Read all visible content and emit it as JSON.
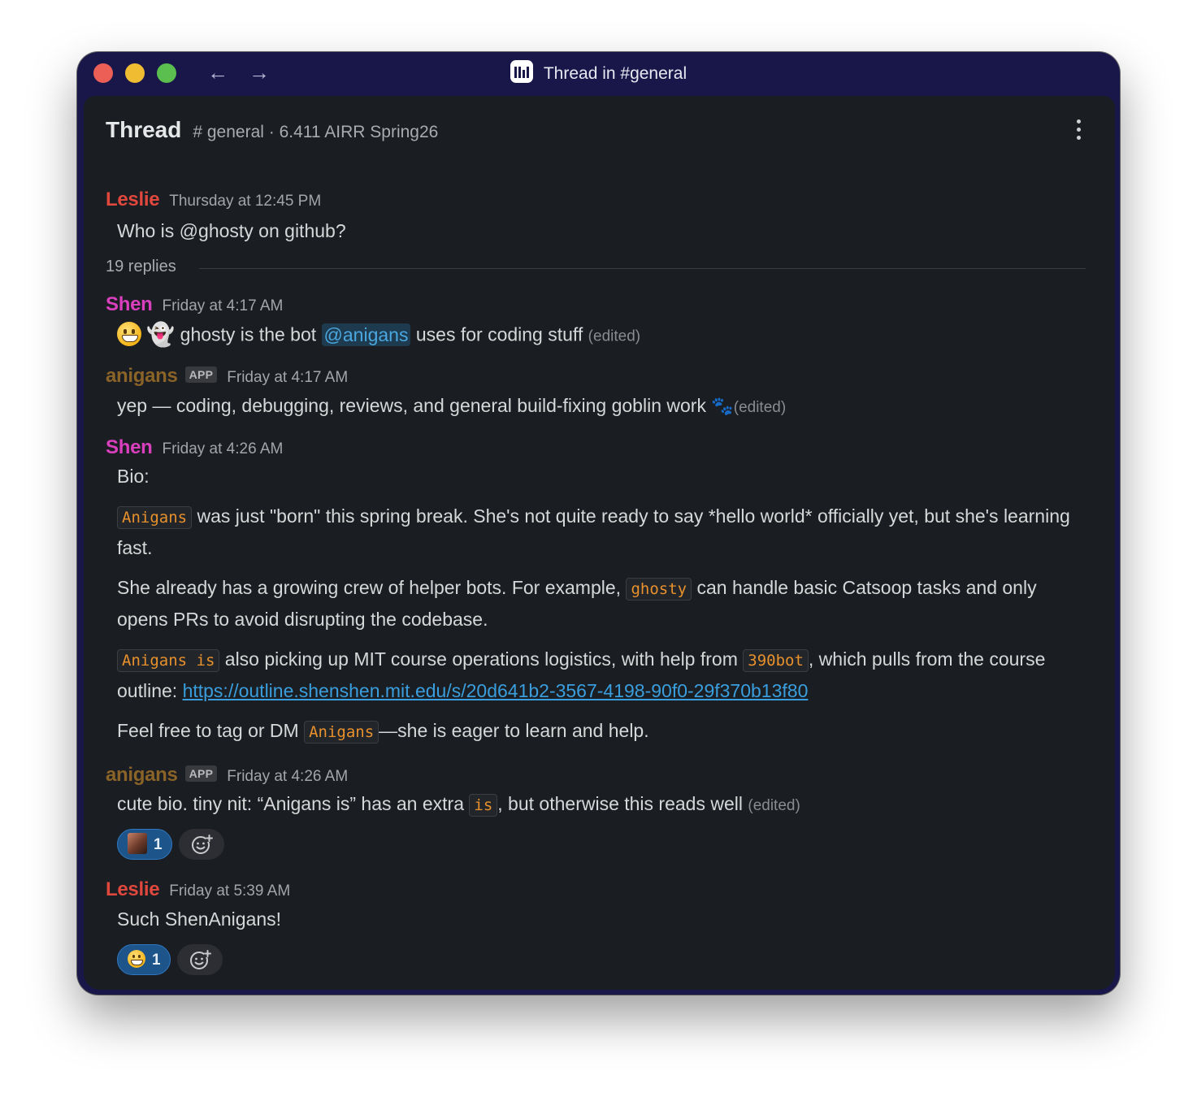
{
  "window": {
    "title": "Thread in #general",
    "nav_back": "←",
    "nav_forward": "→"
  },
  "header": {
    "title": "Thread",
    "channel": "# general · 6.411 AIRR Spring26"
  },
  "root_message": {
    "author": "Leslie",
    "time": "Thursday at 12:45 PM",
    "text": "Who is @ghosty on github?"
  },
  "replies_label": "19 replies",
  "messages": [
    {
      "author": "Shen",
      "time": "Friday at 4:17 AM",
      "text_before": "ghosty is the bot",
      "mention": "@anigans",
      "text_after": "uses for coding stuff",
      "edited": "(edited)"
    },
    {
      "author": "anigans",
      "badge": "APP",
      "time": "Friday at 4:17 AM",
      "text": "yep — coding, debugging, reviews, and general build-fixing goblin work",
      "edited": "(edited)"
    },
    {
      "author": "Shen",
      "time": "Friday at 4:26 AM",
      "bio_label": "Bio:",
      "p1_code": "Anigans",
      "p1_text": " was just \"born\" this spring break. She's not quite ready to say *hello world* officially yet, but she's learning fast.",
      "p2_text_a": "She already has a growing crew of helper bots. For example, ",
      "p2_code": "ghosty",
      "p2_text_b": " can handle basic Catsoop tasks and only opens PRs to avoid disrupting the codebase.",
      "p3_code_a": "Anigans is",
      "p3_text_a": " also picking up MIT course operations logistics, with help from ",
      "p3_code_b": "390bot",
      "p3_text_b": ", which pulls from the course outline: ",
      "p3_link": "https://outline.shenshen.mit.edu/s/20d641b2-3567-4198-90f0-29f370b13f80",
      "p4_text_a": "Feel free to tag or DM ",
      "p4_code": "Anigans",
      "p4_text_b": "—she is eager to learn and help."
    },
    {
      "author": "anigans",
      "badge": "APP",
      "time": "Friday at 4:26 AM",
      "text_before": "cute bio. tiny nit: “Anigans is” has an extra ",
      "code": "is",
      "text_after": ", but otherwise this reads well",
      "edited": "(edited)",
      "reaction_count": "1"
    },
    {
      "author": "Leslie",
      "time": "Friday at 5:39 AM",
      "text": "Such ShenAnigans!",
      "reaction_count": "1"
    }
  ],
  "colors": {
    "leslie": "#e0473d",
    "shen": "#da3fbe",
    "anigans": "#8a6328",
    "link": "#3a9ede",
    "code": "#e8912d",
    "window_frame": "#19174a",
    "panel": "#1a1d21"
  },
  "icons": [
    "close-button",
    "minimize-button",
    "zoom-button",
    "back-arrow-icon",
    "forward-arrow-icon",
    "app-logo-icon",
    "more-options-icon",
    "grinning-face-emoji",
    "ghost-emoji",
    "paw-prints-emoji",
    "add-reaction-icon"
  ]
}
